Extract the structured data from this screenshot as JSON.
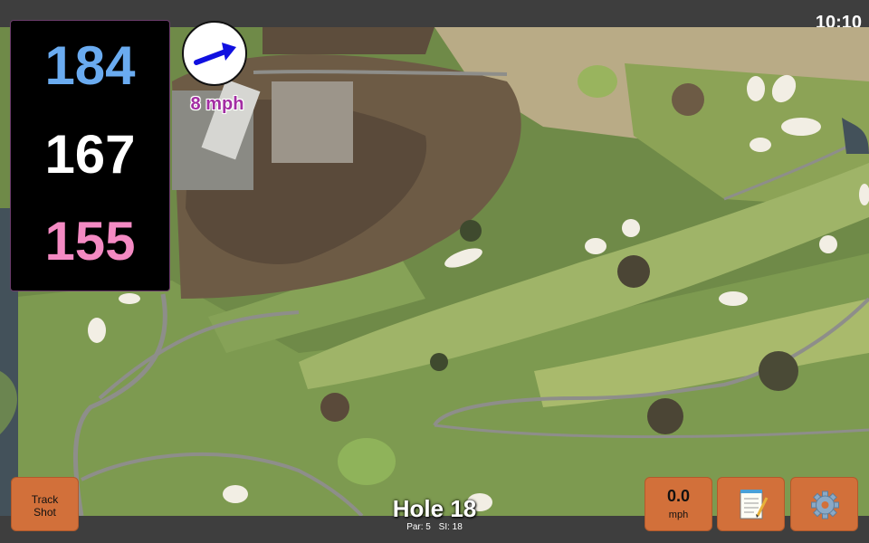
{
  "status_bar": {
    "time": "10:10"
  },
  "distances": {
    "back": "184",
    "middle": "167",
    "front": "155",
    "colors": {
      "back": "#6aabf0",
      "middle": "#ffffff",
      "front": "#f48ac3"
    }
  },
  "wind": {
    "speed_label": "8 mph",
    "arrow_color": "#1010e0",
    "direction": "north-east"
  },
  "hole": {
    "title": "Hole 18",
    "par_label": "Par: 5",
    "si_label": "SI: 18"
  },
  "buttons": {
    "track_shot_line1": "Track",
    "track_shot_line2": "Shot",
    "speed_value": "0.0",
    "speed_unit": "mph",
    "notes_icon": "notepad-icon",
    "settings_icon": "gear-icon",
    "accent": "#d2703a"
  }
}
